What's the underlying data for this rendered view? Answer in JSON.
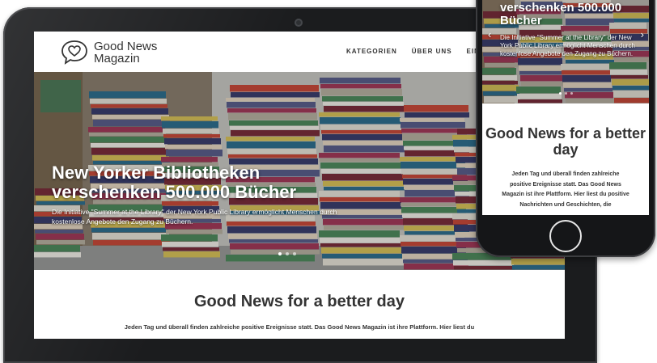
{
  "site": {
    "logo_line1": "Good News",
    "logo_line2": "Magazin",
    "nav": [
      "KATEGORIEN",
      "ÜBER UNS",
      "EINLOGG"
    ]
  },
  "hero": {
    "title": "New Yorker Bibliotheken verschenken 500.000 Bücher",
    "description": "Die Initiative \"Summer at the Library\" der New York Public Library ermöglicht Menschen durch kostenlose Angebote den Zugang zu Büchern.",
    "slide_count": 3,
    "active_slide": 1
  },
  "content": {
    "heading": "Good News for a better day",
    "intro": "Jeden Tag und überall finden zahlreiche positive Ereignisse statt. Das Good News Magazin ist ihre Plattform. Hier liest du"
  },
  "phone": {
    "hero_title": "verschenken 500.000 Bücher",
    "hero_description": "Die Initiative \"Summer at the Library\" der New York Public Library ermöglicht Menschen durch kostenlose Angebote den Zugang zu Büchern.",
    "heading": "Good News for a better day",
    "intro": "Jeden Tag und überall finden zahlreiche positive Ereignisse statt. Das Good News Magazin ist ihre Plattform. Hier liest du positive Nachrichten und Geschichten, die"
  },
  "colors": {
    "frame": "#1b1c1e",
    "text_dark": "#333333"
  }
}
